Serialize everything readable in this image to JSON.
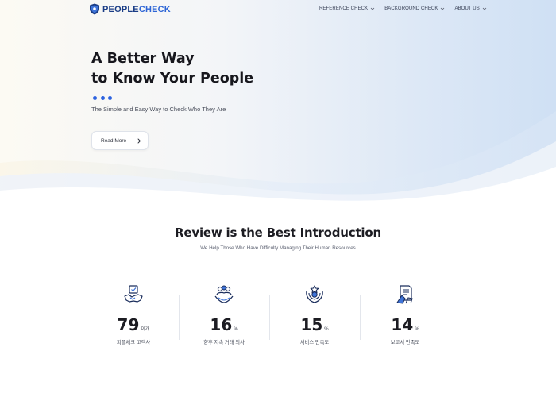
{
  "header": {
    "logo_part_a": "PEOPLE",
    "logo_part_b": "CHECK",
    "logo_icon": "shield-crest-icon",
    "nav": [
      {
        "label": "REFERENCE CHECK"
      },
      {
        "label": "BACKGROUND CHECK"
      },
      {
        "label": "ABOUT US"
      }
    ]
  },
  "hero": {
    "title_line1": "A Better Way",
    "title_line2": "to Know Your People",
    "subtitle": "The Simple and Easy Way to Check Who They Are",
    "read_more_label": "Read More",
    "dot_count": 3
  },
  "section": {
    "title": "Review is the Best Introduction",
    "subtitle": "We Help Those Who Have Difficulty Managing Their Human Resources"
  },
  "stats": [
    {
      "icon": "handshake-icon",
      "value": "79",
      "unit": "이개",
      "label": "피플체크 고객사"
    },
    {
      "icon": "team-hands-icon",
      "value": "16",
      "unit": "%",
      "label": "향후 지속 거래 의사"
    },
    {
      "icon": "award-hands-icon",
      "value": "15",
      "unit": "%",
      "label": "서비스 만족도"
    },
    {
      "icon": "report-document-icon",
      "value": "14",
      "unit": "%",
      "label": "보고서 만족도"
    }
  ],
  "colors": {
    "brand_dark": "#1a3d86",
    "brand_blue": "#2f66d6",
    "accent_dot": "#2d63e0",
    "hero_blue": "#d3e2f5",
    "hero_warm": "#fcf8ee",
    "text_dark": "#1c1c22"
  }
}
